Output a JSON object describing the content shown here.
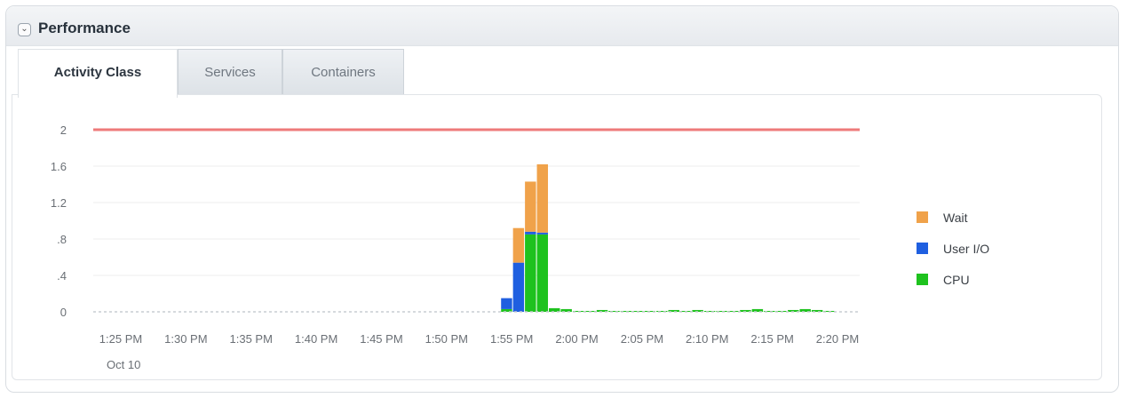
{
  "panel": {
    "title": "Performance",
    "collapse_icon": "chevron-down-icon"
  },
  "tabs": [
    {
      "label": "Activity Class",
      "active": true
    },
    {
      "label": "Services",
      "active": false
    },
    {
      "label": "Containers",
      "active": false
    }
  ],
  "colors": {
    "wait": "#f0a24a",
    "user_io": "#1f5fe0",
    "cpu": "#1ec21e",
    "limit_line": "#ee7a7a",
    "grid": "#eeeeee"
  },
  "chart_data": {
    "type": "bar",
    "stacked": true,
    "title": "",
    "xlabel": "",
    "ylabel": "",
    "ylim": [
      0,
      2
    ],
    "y_ticks": [
      "2",
      "1.6",
      "1.2",
      ".8",
      ".4",
      "0"
    ],
    "y_tick_values": [
      2,
      1.6,
      1.2,
      0.8,
      0.4,
      0
    ],
    "x_tick_labels": [
      "1:25 PM",
      "1:30 PM",
      "1:35 PM",
      "1:40 PM",
      "1:45 PM",
      "1:50 PM",
      "1:55 PM",
      "2:00 PM",
      "2:05 PM",
      "2:10 PM",
      "2:15 PM",
      "2:20 PM"
    ],
    "x_date_label": "Oct 10",
    "x_range_minutes": [
      0,
      60
    ],
    "reference_line": {
      "value": 2
    },
    "legend_position": "right",
    "legend": [
      "Wait",
      "User I/O",
      "CPU"
    ],
    "x_minutes": [
      32.3,
      33.3,
      34.3,
      35.3,
      36.3,
      37.3,
      38.3,
      39.3,
      40.3,
      41.3,
      42.3,
      43.3,
      44.3,
      45.3,
      46.3,
      47.3,
      48.3,
      49.3,
      50.3,
      51.3,
      52.3,
      53.3,
      54.3,
      55.3,
      56.3,
      57.3,
      58.3,
      59.3
    ],
    "series": [
      {
        "name": "CPU",
        "values": [
          0.03,
          0.0,
          0.85,
          0.85,
          0.04,
          0.03,
          0.01,
          0.01,
          0.02,
          0.01,
          0.01,
          0.01,
          0.01,
          0.01,
          0.02,
          0.01,
          0.02,
          0.01,
          0.01,
          0.01,
          0.02,
          0.03,
          0.01,
          0.01,
          0.02,
          0.03,
          0.02,
          0.01
        ]
      },
      {
        "name": "User I/O",
        "values": [
          0.12,
          0.54,
          0.03,
          0.02,
          0.0,
          0.0,
          0.0,
          0.0,
          0.0,
          0.0,
          0.0,
          0.0,
          0.0,
          0.0,
          0.0,
          0.0,
          0.0,
          0.0,
          0.0,
          0.0,
          0.0,
          0.0,
          0.0,
          0.0,
          0.0,
          0.0,
          0.0,
          0.0
        ]
      },
      {
        "name": "Wait",
        "values": [
          0.0,
          0.38,
          0.55,
          0.75,
          0.0,
          0.0,
          0.0,
          0.0,
          0.0,
          0.0,
          0.0,
          0.0,
          0.0,
          0.0,
          0.0,
          0.0,
          0.0,
          0.0,
          0.0,
          0.0,
          0.0,
          0.0,
          0.0,
          0.0,
          0.0,
          0.0,
          0.0,
          0.0
        ]
      }
    ]
  }
}
